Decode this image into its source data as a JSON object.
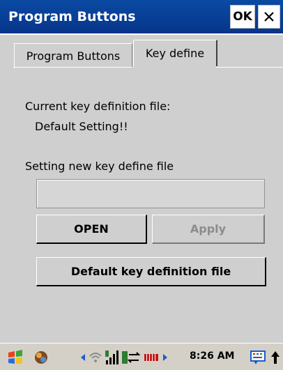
{
  "window": {
    "title": "Program Buttons",
    "ok_label": "OK",
    "close_icon": "close-icon"
  },
  "tabs": [
    {
      "label": "Program Buttons",
      "active": false
    },
    {
      "label": "Key define",
      "active": true
    }
  ],
  "content": {
    "current_file_label": "Current key definition file:",
    "current_file_value": "Default Setting!!",
    "new_file_label": "Setting new key define file",
    "new_file_value": "",
    "open_label": "OPEN",
    "apply_label": "Apply",
    "default_label": "Default key definition file"
  },
  "taskbar": {
    "clock": "8:26 AM",
    "icons": [
      "start-icon",
      "settings-icon",
      "wifi-icon",
      "signal-icon",
      "sync-icon",
      "battery-icon",
      "keyboard-icon",
      "up-arrow-icon"
    ]
  },
  "colors": {
    "titlebar": "#07358a",
    "content_bg": "#cfcfcf"
  }
}
